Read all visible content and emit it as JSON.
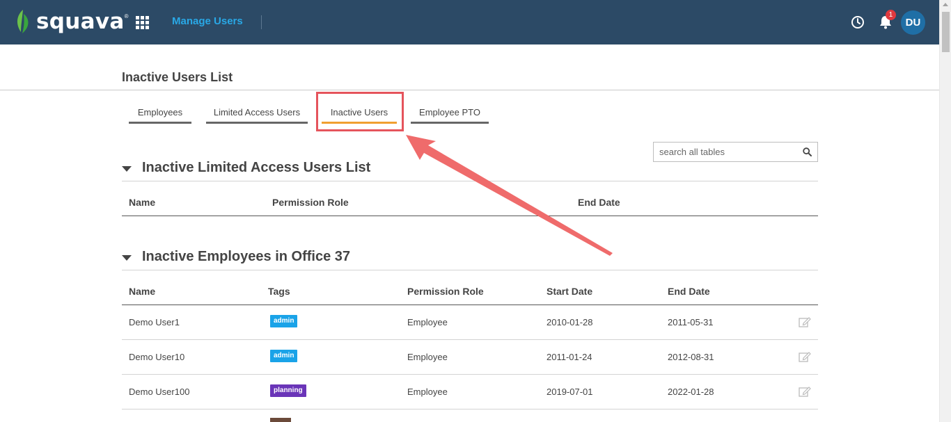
{
  "header": {
    "logo_text": "squava",
    "logo_mark": "®",
    "nav_title": "Manage Users",
    "notification_count": "1",
    "avatar_initials": "DU"
  },
  "page": {
    "title": "Inactive Users List"
  },
  "tabs": [
    {
      "label": "Employees"
    },
    {
      "label": "Limited Access Users"
    },
    {
      "label": "Inactive Users"
    },
    {
      "label": "Employee PTO"
    }
  ],
  "search": {
    "placeholder": "search all tables"
  },
  "limited_section": {
    "title": "Inactive Limited Access Users List",
    "columns": [
      "Name",
      "Permission Role",
      "End Date"
    ]
  },
  "employees_section": {
    "title": "Inactive Employees in Office 37",
    "columns": [
      "Name",
      "Tags",
      "Permission Role",
      "Start Date",
      "End Date"
    ],
    "rows": [
      {
        "name": "Demo User1",
        "tag": "admin",
        "role": "Employee",
        "start": "2010-01-28",
        "end": "2011-05-31"
      },
      {
        "name": "Demo User10",
        "tag": "admin",
        "role": "Employee",
        "start": "2011-01-24",
        "end": "2012-08-31"
      },
      {
        "name": "Demo User100",
        "tag": "planning",
        "role": "Employee",
        "start": "2019-07-01",
        "end": "2022-01-28"
      }
    ]
  },
  "colors": {
    "topbar": "#2c4a66",
    "accent": "#29a8e6",
    "active_tab": "#f0a030",
    "annotation": "#e5545c",
    "tag_admin": "#1aa3e8",
    "tag_planning": "#6a35b8"
  }
}
